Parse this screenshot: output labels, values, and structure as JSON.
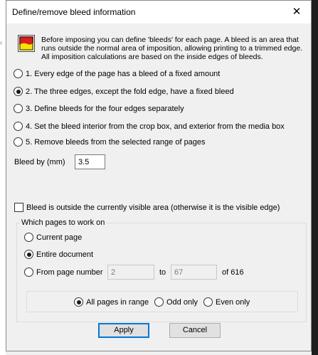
{
  "dialog": {
    "title": "Define/remove bleed information",
    "info": "Before imposing you can define 'bleeds' for each page. A bleed is an area that runs outside the normal area of imposition, allowing printing to a trimmed edge. All imposition calculations are based on the inside edges of bleeds."
  },
  "options": [
    {
      "label": "1. Every edge of the page has a bleed of a fixed amount",
      "selected": false
    },
    {
      "label": "2. The three edges, except the fold edge, have a fixed bleed",
      "selected": true
    },
    {
      "label": "3. Define bleeds for the four edges separately",
      "selected": false
    },
    {
      "label": "4. Set the bleed interior from the crop box, and exterior from the media box",
      "selected": false
    },
    {
      "label": "5. Remove bleeds from the selected range of pages",
      "selected": false
    }
  ],
  "bleed": {
    "label": "Bleed by (mm)",
    "value": "3.5"
  },
  "outside_checkbox": {
    "label": "Bleed is outside the currently visible area (otherwise it is the visible edge)",
    "checked": false
  },
  "pages": {
    "group_title": "Which pages to work on",
    "current_page": "Current page",
    "entire_document": "Entire document",
    "from_page_number": "From page number",
    "from_value": "2",
    "to_label": "to",
    "to_value": "67",
    "of_label": "of 616",
    "all_pages": "All pages in range",
    "odd_only": "Odd only",
    "even_only": "Even only"
  },
  "buttons": {
    "apply": "Apply",
    "cancel": "Cancel"
  },
  "colors": {
    "default_button_border": "#0078d7",
    "icon_red": "#d42020",
    "icon_yellow": "#f5e400"
  }
}
